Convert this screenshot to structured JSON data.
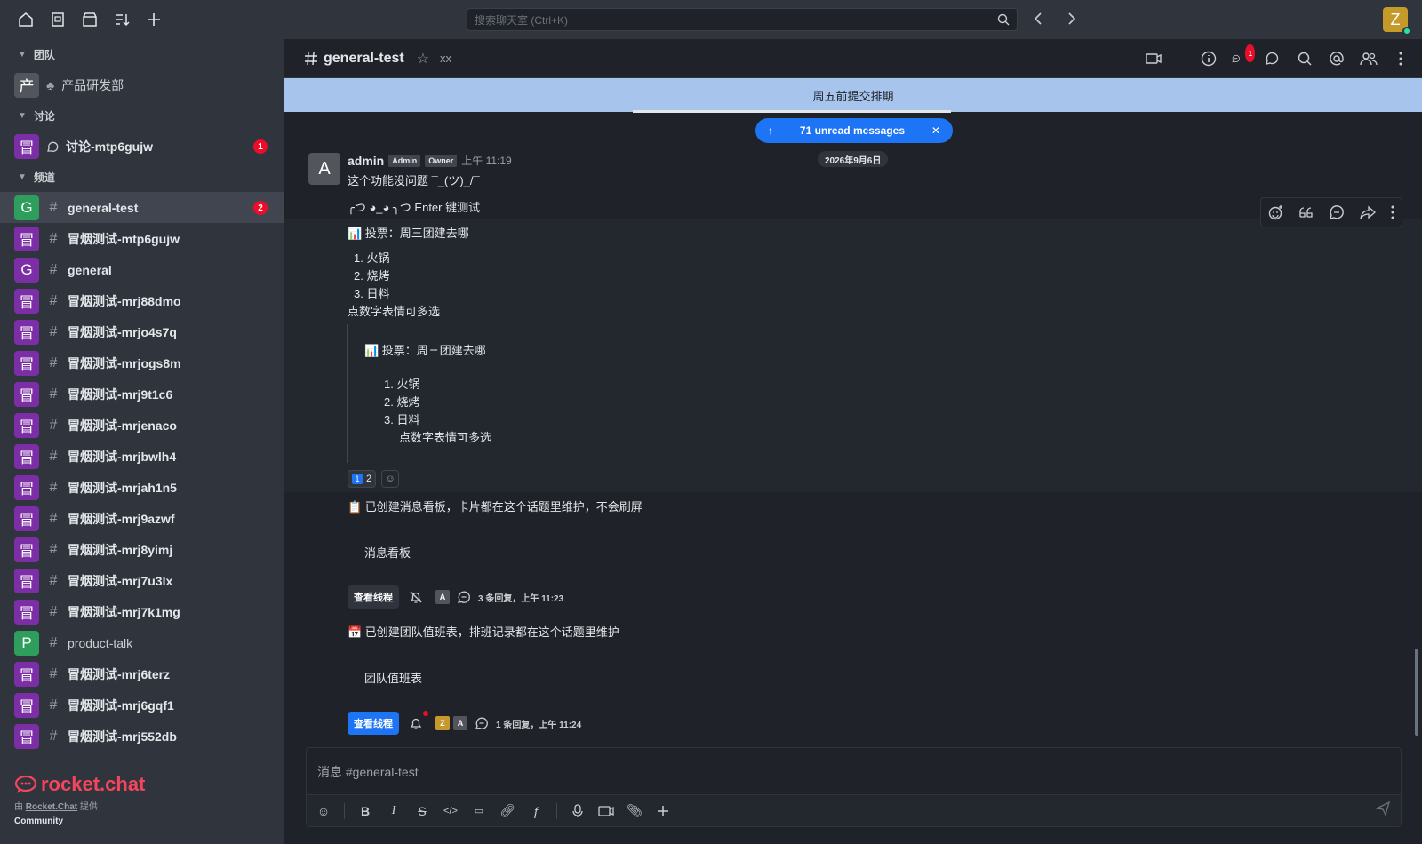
{
  "search": {
    "placeholder": "搜索聊天室 (Ctrl+K)"
  },
  "user": {
    "initial": "Z"
  },
  "sidebar": {
    "sections": [
      {
        "label": "团队"
      },
      {
        "label": "讨论"
      },
      {
        "label": "频道"
      }
    ],
    "team_item": {
      "initial": "产",
      "label": "产品研发部",
      "color": "#52565c"
    },
    "discussion_item": {
      "initial": "冒",
      "label": "讨论-mtp6gujw",
      "badge": "1",
      "color": "#7b2ea6"
    },
    "channels": [
      {
        "initial": "G",
        "label": "general-test",
        "badge": "2",
        "color": "#2e9e5d",
        "active": true,
        "bold": true
      },
      {
        "initial": "冒",
        "label": "冒烟测试-mtp6gujw",
        "color": "#7b2ea6",
        "bold": true
      },
      {
        "initial": "G",
        "label": "general",
        "color": "#7b2ea6",
        "bold": true
      },
      {
        "initial": "冒",
        "label": "冒烟测试-mrj88dmo",
        "color": "#7b2ea6",
        "bold": true
      },
      {
        "initial": "冒",
        "label": "冒烟测试-mrjo4s7q",
        "color": "#7b2ea6",
        "bold": true
      },
      {
        "initial": "冒",
        "label": "冒烟测试-mrjogs8m",
        "color": "#7b2ea6",
        "bold": true
      },
      {
        "initial": "冒",
        "label": "冒烟测试-mrj9t1c6",
        "color": "#7b2ea6",
        "bold": true
      },
      {
        "initial": "冒",
        "label": "冒烟测试-mrjenaco",
        "color": "#7b2ea6",
        "bold": true
      },
      {
        "initial": "冒",
        "label": "冒烟测试-mrjbwlh4",
        "color": "#7b2ea6",
        "bold": true
      },
      {
        "initial": "冒",
        "label": "冒烟测试-mrjah1n5",
        "color": "#7b2ea6",
        "bold": true
      },
      {
        "initial": "冒",
        "label": "冒烟测试-mrj9azwf",
        "color": "#7b2ea6",
        "bold": true
      },
      {
        "initial": "冒",
        "label": "冒烟测试-mrj8yimj",
        "color": "#7b2ea6",
        "bold": true
      },
      {
        "initial": "冒",
        "label": "冒烟测试-mrj7u3lx",
        "color": "#7b2ea6",
        "bold": true
      },
      {
        "initial": "冒",
        "label": "冒烟测试-mrj7k1mg",
        "color": "#7b2ea6",
        "bold": true
      },
      {
        "initial": "P",
        "label": "product-talk",
        "color": "#2e9e5d",
        "bold": false
      },
      {
        "initial": "冒",
        "label": "冒烟测试-mrj6terz",
        "color": "#7b2ea6",
        "bold": true
      },
      {
        "initial": "冒",
        "label": "冒烟测试-mrj6gqf1",
        "color": "#7b2ea6",
        "bold": true
      },
      {
        "initial": "冒",
        "label": "冒烟测试-mrj552db",
        "color": "#7b2ea6",
        "bold": true
      }
    ],
    "brand": "rocket.chat",
    "powered_prefix": "由 ",
    "powered_name": "Rocket.Chat",
    "powered_suffix": " 提供",
    "community": "Community"
  },
  "room": {
    "title": "general-test",
    "topic": "xx",
    "thread_badge": "1",
    "announcement": "周五前提交排期",
    "unread_label": "71 unread messages",
    "date_chip": "2026年9月6日"
  },
  "message": {
    "avatar": "A",
    "username": "admin",
    "roles": [
      "Admin",
      "Owner"
    ],
    "time": "上午 11:19",
    "lines": [
      "这个功能没问题 ¯_(ツ)_/¯",
      "╭つ ◕_◕ ╮つ Enter 键测试",
      "📊 投票：周三团建去哪",
      "1.  火锅",
      "2.  烧烤",
      "3.  日料",
      "点数字表情可多选"
    ],
    "quote": {
      "title": "📊 投票：周三团建去哪",
      "items": [
        "1. 火锅",
        "2. 烧烤",
        "3. 日料"
      ],
      "note": "点数字表情可多选"
    },
    "reaction_count": "2",
    "reaction_emoji": "1"
  },
  "boards": [
    {
      "title": "📋 已创建消息看板，卡片都在这个话题里维护，不会刷屏",
      "body": "消息看板",
      "button": "查看线程",
      "avatars": [
        "A"
      ],
      "meta": "3 条回复，上午 11:23"
    },
    {
      "title": "📅 已创建团队值班表，排班记录都在这个话题里维护",
      "body": "团队值班表",
      "button": "查看线程",
      "avatars": [
        "Z",
        "A"
      ],
      "meta": "1 条回复，上午 11:24"
    }
  ],
  "composer": {
    "placeholder": "消息 #general-test"
  },
  "colors": {
    "accent": "#1d74f5",
    "badge": "#ec0d2a",
    "announcement": "#a7c4ec"
  }
}
